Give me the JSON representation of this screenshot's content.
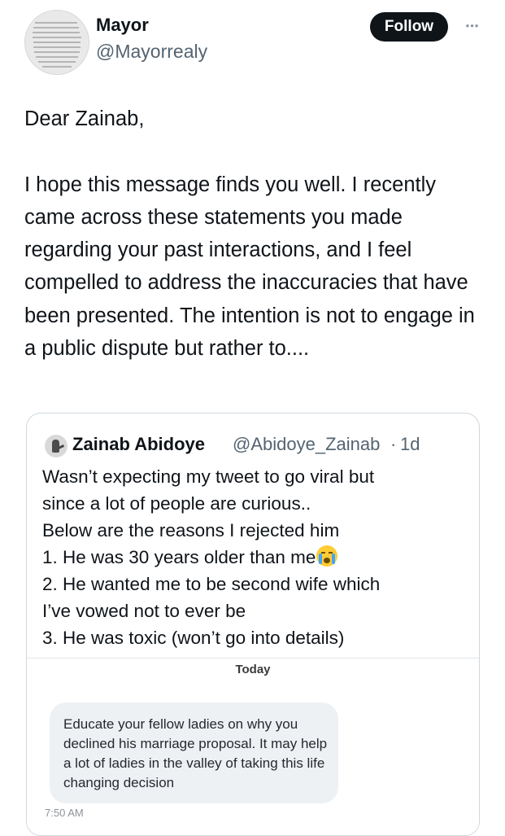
{
  "author": {
    "display_name": "Mayor",
    "handle": "@Mayorrealy"
  },
  "actions": {
    "follow_label": "Follow",
    "more_label": "•••"
  },
  "tweet": {
    "text": "Dear Zainab,\n\nI hope this message finds you well. I recently came across these statements you made regarding  your past interactions, and I feel compelled to address the inaccuracies that have been presented. The intention is not to engage in a public dispute but rather to...."
  },
  "quoted_tweet": {
    "author_name": "Zainab Abidoye",
    "author_handle": "@Abidoye_Zainab",
    "separator": "·",
    "time": "1d",
    "lines": {
      "l1": "Wasn’t expecting my tweet to go viral but",
      "l2": "since a lot of people are curious..",
      "l3": "Below are the reasons I rejected him",
      "l4": "1. He was 30 years older than me",
      "l5": "2. He wanted me to be second wife which",
      "l6": "I’ve vowed not to ever be",
      "l7": "3. He was toxic (won’t go into details)"
    },
    "emoji": "crying-face",
    "screenshot": {
      "day_label": "Today",
      "message": "Educate your fellow ladies on why you declined his marriage proposal. It may help a lot of ladies in the valley of taking this life changing decision",
      "message_time": "7:50 AM"
    }
  },
  "colors": {
    "text_primary": "#0f1419",
    "text_secondary": "#536471",
    "follow_bg": "#0f1419",
    "card_border": "#cfd9de",
    "bubble_bg": "#eef1f4"
  }
}
